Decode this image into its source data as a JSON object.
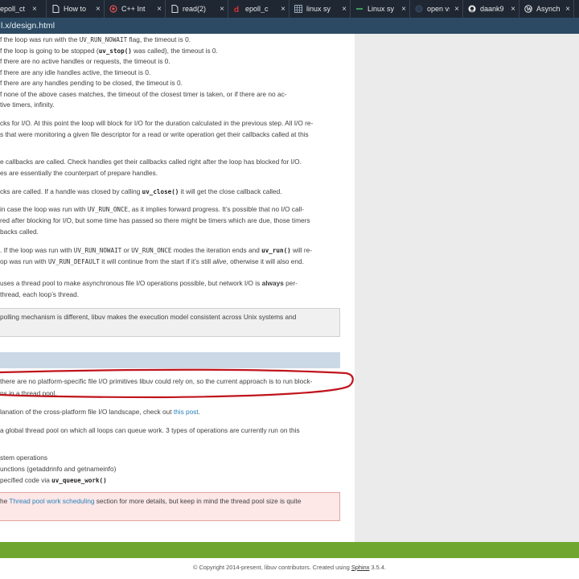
{
  "tabs": [
    {
      "label": "epoll_ct",
      "icon": "page-icon"
    },
    {
      "label": "How to",
      "icon": "page-icon"
    },
    {
      "label": "C++ Int",
      "icon": "cpp-icon"
    },
    {
      "label": "read(2)",
      "icon": "page-icon"
    },
    {
      "label": "epoll_c",
      "icon": "d-logo-icon"
    },
    {
      "label": "linux sy",
      "icon": "grid-icon"
    },
    {
      "label": "Linux sy",
      "icon": "dash-icon"
    },
    {
      "label": "open vs",
      "icon": "globe-icon"
    },
    {
      "label": "daank9",
      "icon": "github-icon"
    },
    {
      "label": "Asynchr",
      "icon": "wordpress-icon"
    }
  ],
  "tab_close": "×",
  "url": "l.x/design.html",
  "doc": {
    "l1": [
      "f the loop was run with the ",
      "UV_RUN_NOWAIT",
      " flag, the timeout is 0."
    ],
    "l2": [
      "f the loop is going to be stopped (",
      "uv_stop()",
      " was called), the timeout is 0."
    ],
    "l3": "f there are no active handles or requests, the timeout is 0.",
    "l4": "f there are any idle handles active, the timeout is 0.",
    "l5": "f there are any handles pending to be closed, the timeout is 0.",
    "l6": "f none of the above cases matches, the timeout of the closest timer is taken, or if there are no ac-",
    "l7": "tive timers, infinity.",
    "l8": "cks for I/O. At this point the loop will block for I/O for the duration calculated in the previous step. All I/O re-",
    "l9": "s that were monitoring a given file descriptor for a read or write operation get their callbacks called at this",
    "l10": "e callbacks are called. Check handles get their callbacks called right after the loop has blocked for I/O.",
    "l11": "es are essentially the counterpart of prepare handles.",
    "l12": [
      "cks are called. If a handle was closed by calling ",
      "uv_close()",
      " it will get the close callback called."
    ],
    "l13": [
      "in case the loop was run with ",
      "UV_RUN_ONCE",
      ", as it implies forward progress. It’s possible that no I/O call-"
    ],
    "l14": "red after blocking for I/O, but some time has passed so there might be timers which are due, those timers",
    "l15": "backs called.",
    "l16": [
      ". If the loop was run with ",
      "UV_RUN_NOWAIT",
      " or ",
      "UV_RUN_ONCE",
      " modes the iteration ends and ",
      "uv_run()",
      " will re-"
    ],
    "l17": [
      "op was run with ",
      "UV_RUN_DEFAULT",
      " it will continue from the start if it’s still ",
      "alive",
      ", otherwise it will also end."
    ],
    "l18": [
      "uses a thread pool to make asynchronous file I/O operations possible, but network I/O is ",
      "always",
      " per-"
    ],
    "l19": "thread, each loop’s thread.",
    "note1": "polling mechanism is different, libuv makes the execution model consistent across Unix systems and",
    "l20": "there are no platform-specific file I/O primitives libuv could rely on, so the current approach is to run block-",
    "l21": "ns in a thread pool.",
    "l22": [
      "lanation of the cross-platform file I/O landscape, check out ",
      "this post",
      "."
    ],
    "l23": "a global thread pool on which all loops can queue work. 3 types of operations are currently run on this",
    "l24": "stem operations",
    "l25": "unctions (getaddrinfo and getnameinfo)",
    "l26": [
      "pecified code via ",
      "uv_queue_work()"
    ],
    "warn": [
      "he ",
      "Thread pool work scheduling",
      " section for more details, but keep in mind the thread pool size is quite"
    ]
  },
  "footer": {
    "prefix": "© Copyright 2014-present, libuv contributors. Created using ",
    "link": "Sphinx",
    "suffix": " 3.5.4."
  },
  "colors": {
    "link": "#2980b9",
    "annotation": "#c0141c",
    "green_bar": "#6fa62f",
    "tabbar": "#1f2733",
    "urlbar": "#2c4a63"
  }
}
